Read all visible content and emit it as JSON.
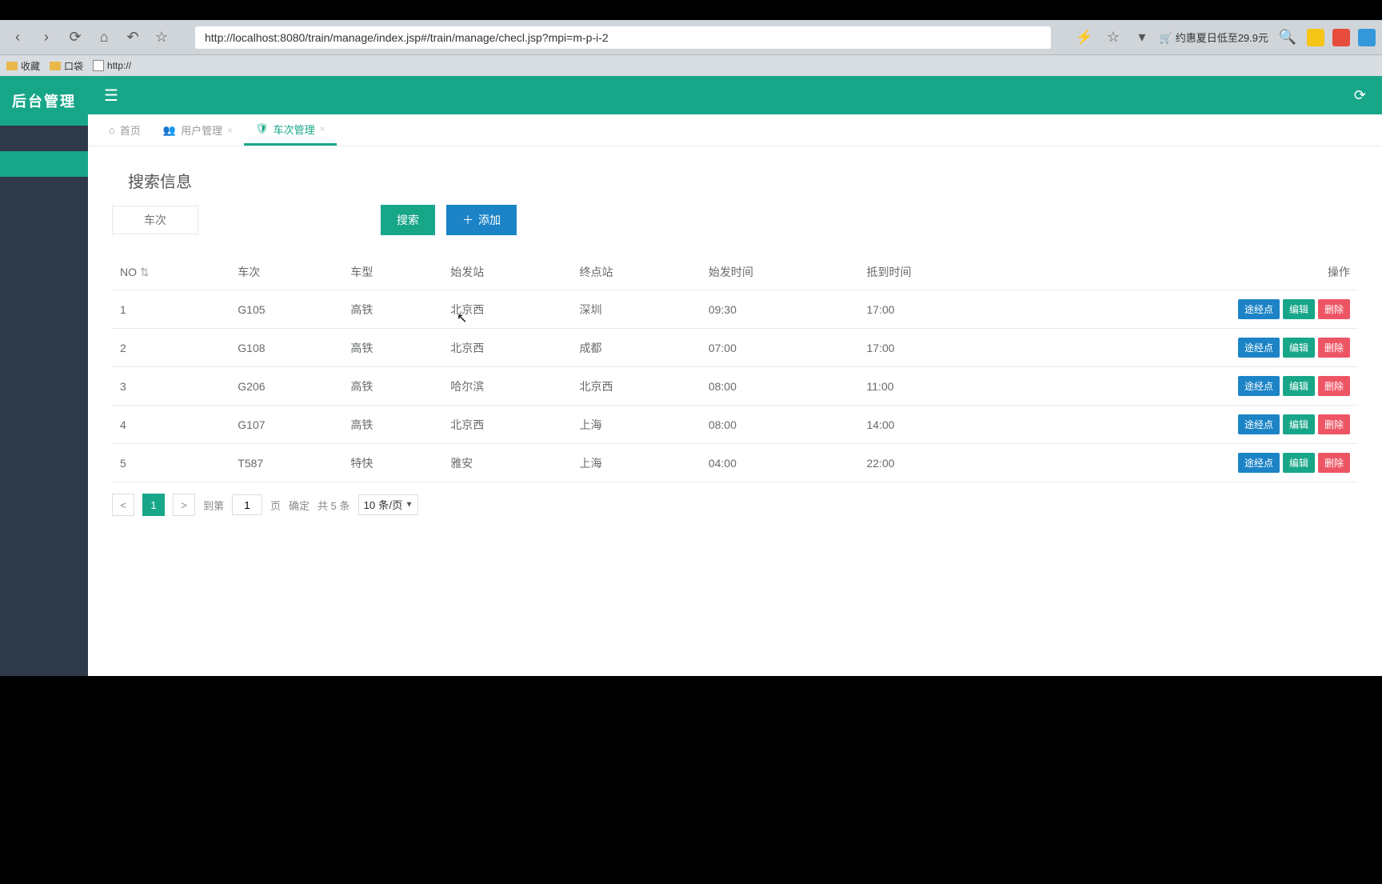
{
  "browser": {
    "url": "http://localhost:8080/train/manage/index.jsp#/train/manage/checl.jsp?mpi=m-p-i-2",
    "promo": "🛒 约惠夏日低至29.9元"
  },
  "bookmarks": {
    "b1": "收藏",
    "b2": "口袋",
    "b3": "http://"
  },
  "sidebar": {
    "title": "后台管理"
  },
  "tabs": {
    "home": "首页",
    "users": "用户管理",
    "trains": "车次管理"
  },
  "search": {
    "title": "搜索信息",
    "placeholder": "车次",
    "search_btn": "搜索",
    "add_btn": "添加"
  },
  "table": {
    "headers": {
      "no": "NO",
      "train": "车次",
      "type": "车型",
      "from": "始发站",
      "to": "终点站",
      "depart": "始发时间",
      "arrive": "抵到时间",
      "ops": "操作"
    },
    "rows": [
      {
        "no": "1",
        "train": "G105",
        "type": "高铁",
        "from": "北京西",
        "to": "深圳",
        "depart": "09:30",
        "arrive": "17:00"
      },
      {
        "no": "2",
        "train": "G108",
        "type": "高铁",
        "from": "北京西",
        "to": "成都",
        "depart": "07:00",
        "arrive": "17:00"
      },
      {
        "no": "3",
        "train": "G206",
        "type": "高铁",
        "from": "哈尔滨",
        "to": "北京西",
        "depart": "08:00",
        "arrive": "11:00"
      },
      {
        "no": "4",
        "train": "G107",
        "type": "高铁",
        "from": "北京西",
        "to": "上海",
        "depart": "08:00",
        "arrive": "14:00"
      },
      {
        "no": "5",
        "train": "T587",
        "type": "特快",
        "from": "雅安",
        "to": "上海",
        "depart": "04:00",
        "arrive": "22:00"
      }
    ],
    "ops": {
      "stops": "途经点",
      "edit": "编辑",
      "del": "删除"
    }
  },
  "pager": {
    "current": "1",
    "goto_label": "到第",
    "goto_value": "1",
    "page_unit": "页",
    "confirm": "确定",
    "total": "共 5 条",
    "per_page": "10 条/页"
  }
}
